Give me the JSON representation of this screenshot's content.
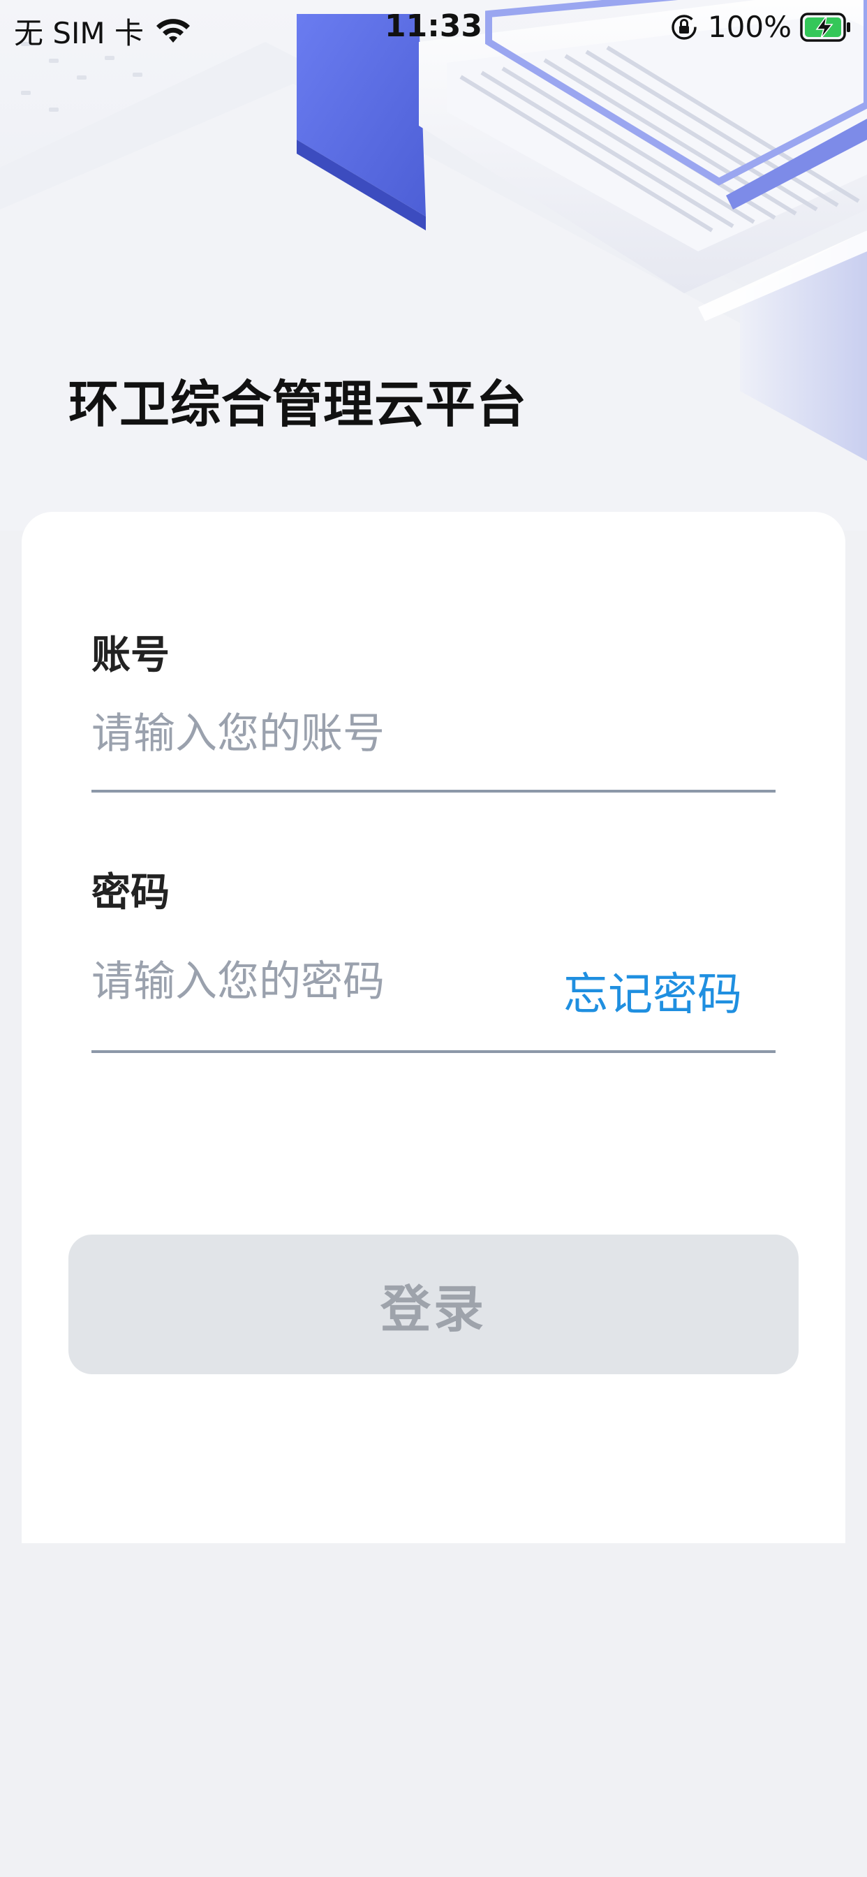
{
  "status_bar": {
    "carrier": "无 SIM 卡",
    "time": "11:33",
    "battery_percent": "100%",
    "icons": [
      "wifi-icon",
      "orientation-lock-icon",
      "battery-charging-icon"
    ]
  },
  "app": {
    "title": "环卫综合管理云平台"
  },
  "form": {
    "account_label": "账号",
    "account_placeholder": "请输入您的账号",
    "account_value": "",
    "password_label": "密码",
    "password_placeholder": "请输入您的密码",
    "password_value": "",
    "forgot_password": "忘记密码",
    "login_button": "登录"
  },
  "colors": {
    "accent": "#1f8fe0",
    "button_disabled_bg": "#e1e4e8",
    "button_disabled_text": "#9ea3ab",
    "page_bg": "#f0f1f4",
    "hero_blue": "#5b6de0"
  }
}
